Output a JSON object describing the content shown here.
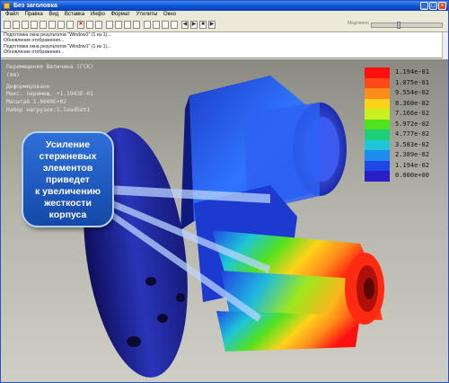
{
  "window": {
    "title": "Без заголовка"
  },
  "menu": [
    "Файл",
    "Правка",
    "Вид",
    "Вставка",
    "Инфо",
    "Формат",
    "Утилиты",
    "Окно"
  ],
  "toolbar": {
    "slider_label": "Медленно"
  },
  "log": [
    "Подготовка окна результатов \"Window1\" (1 из 1)...",
    "Обновление отображения...",
    "Подготовка окна результатов \"Window1\" (1 из 1)...",
    "Обновление отображения..."
  ],
  "hud": {
    "line1": "Перемещения  Величина  (ГСК)",
    "line2": "(mm)",
    "line3": "Деформировано",
    "line4": "Макс.  перемещ.     +1.1943E-01",
    "line5": "Масштаб         1.0000E+02",
    "line6": "Набор  нагрузок:1.load5et1"
  },
  "legend": [
    {
      "value": "1.194e-01",
      "color": "#ff1010"
    },
    {
      "value": "1.075e-01",
      "color": "#ff4a18"
    },
    {
      "value": "9.554e-02",
      "color": "#ff8c1a"
    },
    {
      "value": "8.360e-02",
      "color": "#ffd21a"
    },
    {
      "value": "7.166e-02",
      "color": "#c8f01e"
    },
    {
      "value": "5.972e-02",
      "color": "#52e11f"
    },
    {
      "value": "4.777e-02",
      "color": "#1ecf7a"
    },
    {
      "value": "3.583e-02",
      "color": "#1ec6d6"
    },
    {
      "value": "2.389e-02",
      "color": "#1f8cf0"
    },
    {
      "value": "1.194e-02",
      "color": "#1f46e6"
    },
    {
      "value": "0.000e+00",
      "color": "#2a1ec8"
    }
  ],
  "callout": {
    "lines": [
      "Усиление",
      "стержневых",
      "элементов",
      "приведет",
      "к увеличению",
      "жесткости",
      "корпуса"
    ]
  },
  "colors": {
    "accent": "#1449a8",
    "bg_top": "#8a8a82",
    "bg_bottom": "#cfcfc5"
  }
}
